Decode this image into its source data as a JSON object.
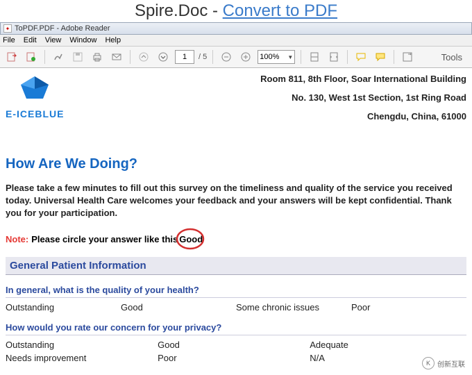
{
  "banner": {
    "prefix": "Spire.Doc - ",
    "link": "Convert to PDF"
  },
  "window": {
    "title": "ToPDF.PDF - Adobe Reader"
  },
  "menu": {
    "file": "File",
    "edit": "Edit",
    "view": "View",
    "window": "Window",
    "help": "Help"
  },
  "toolbar": {
    "page_current": "1",
    "page_total": "/ 5",
    "zoom": "100%",
    "tools": "Tools"
  },
  "logo": {
    "name": "E-ICEBLUE"
  },
  "address": {
    "line1": "Room 811, 8th Floor, Soar International Building",
    "line2": "No. 130, West 1st Section, 1st Ring Road",
    "line3": "Chengdu, China, 61000"
  },
  "heading": "How Are We Doing?",
  "intro": "Please take a few minutes to fill out this survey on the timeliness and quality of the service you received today. Universal Health Care welcomes your feedback and your answers will be kept confidential. Thank you for your participation.",
  "note": {
    "label": "Note:",
    "text": "Please circle your answer like this",
    "circled": "Good"
  },
  "section": "General Patient Information",
  "q1": {
    "text": "In general, what is the quality of your health?",
    "opts": [
      "Outstanding",
      "Good",
      "Some chronic issues",
      "Poor"
    ]
  },
  "q2": {
    "text": "How would you rate our concern for your privacy?",
    "opts_row1": [
      "Outstanding",
      "Good",
      "Adequate"
    ],
    "opts_row2": [
      "Needs improvement",
      "Poor",
      "N/A"
    ]
  },
  "watermark": {
    "logo": "K",
    "text": "创新互联"
  }
}
